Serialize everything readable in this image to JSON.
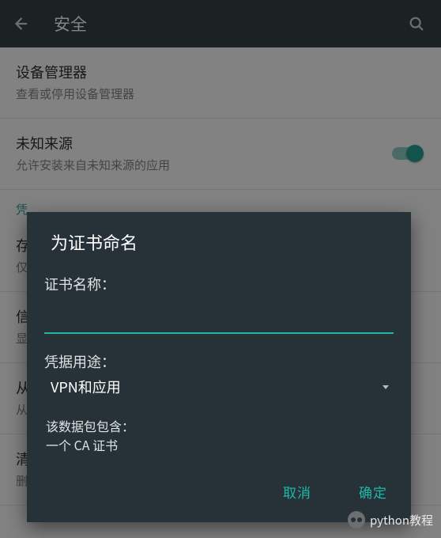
{
  "header": {
    "title": "安全"
  },
  "settings": {
    "deviceAdmin": {
      "title": "设备管理器",
      "sub": "查看或停用设备管理器"
    },
    "unknownSources": {
      "title": "未知来源",
      "sub": "允许安装来自未知来源的应用",
      "enabled": true
    },
    "sectionCredential": "凭",
    "storage": {
      "title_partial": "存",
      "sub_partial": "仅"
    },
    "trusted": {
      "title_partial": "信",
      "sub_partial": "显"
    },
    "install": {
      "title_partial": "从",
      "sub_partial": "从"
    },
    "clear": {
      "title_partial": "清",
      "sub_partial": "删"
    }
  },
  "dialog": {
    "title": "为证书命名",
    "name_label": "证书名称：",
    "name_value": "",
    "usage_label": "凭据用途：",
    "usage_value": "VPN和应用",
    "note_heading": "该数据包包含：",
    "note_line": "一个 CA 证书",
    "cancel": "取消",
    "ok": "确定"
  },
  "watermark": {
    "text": "python教程"
  }
}
